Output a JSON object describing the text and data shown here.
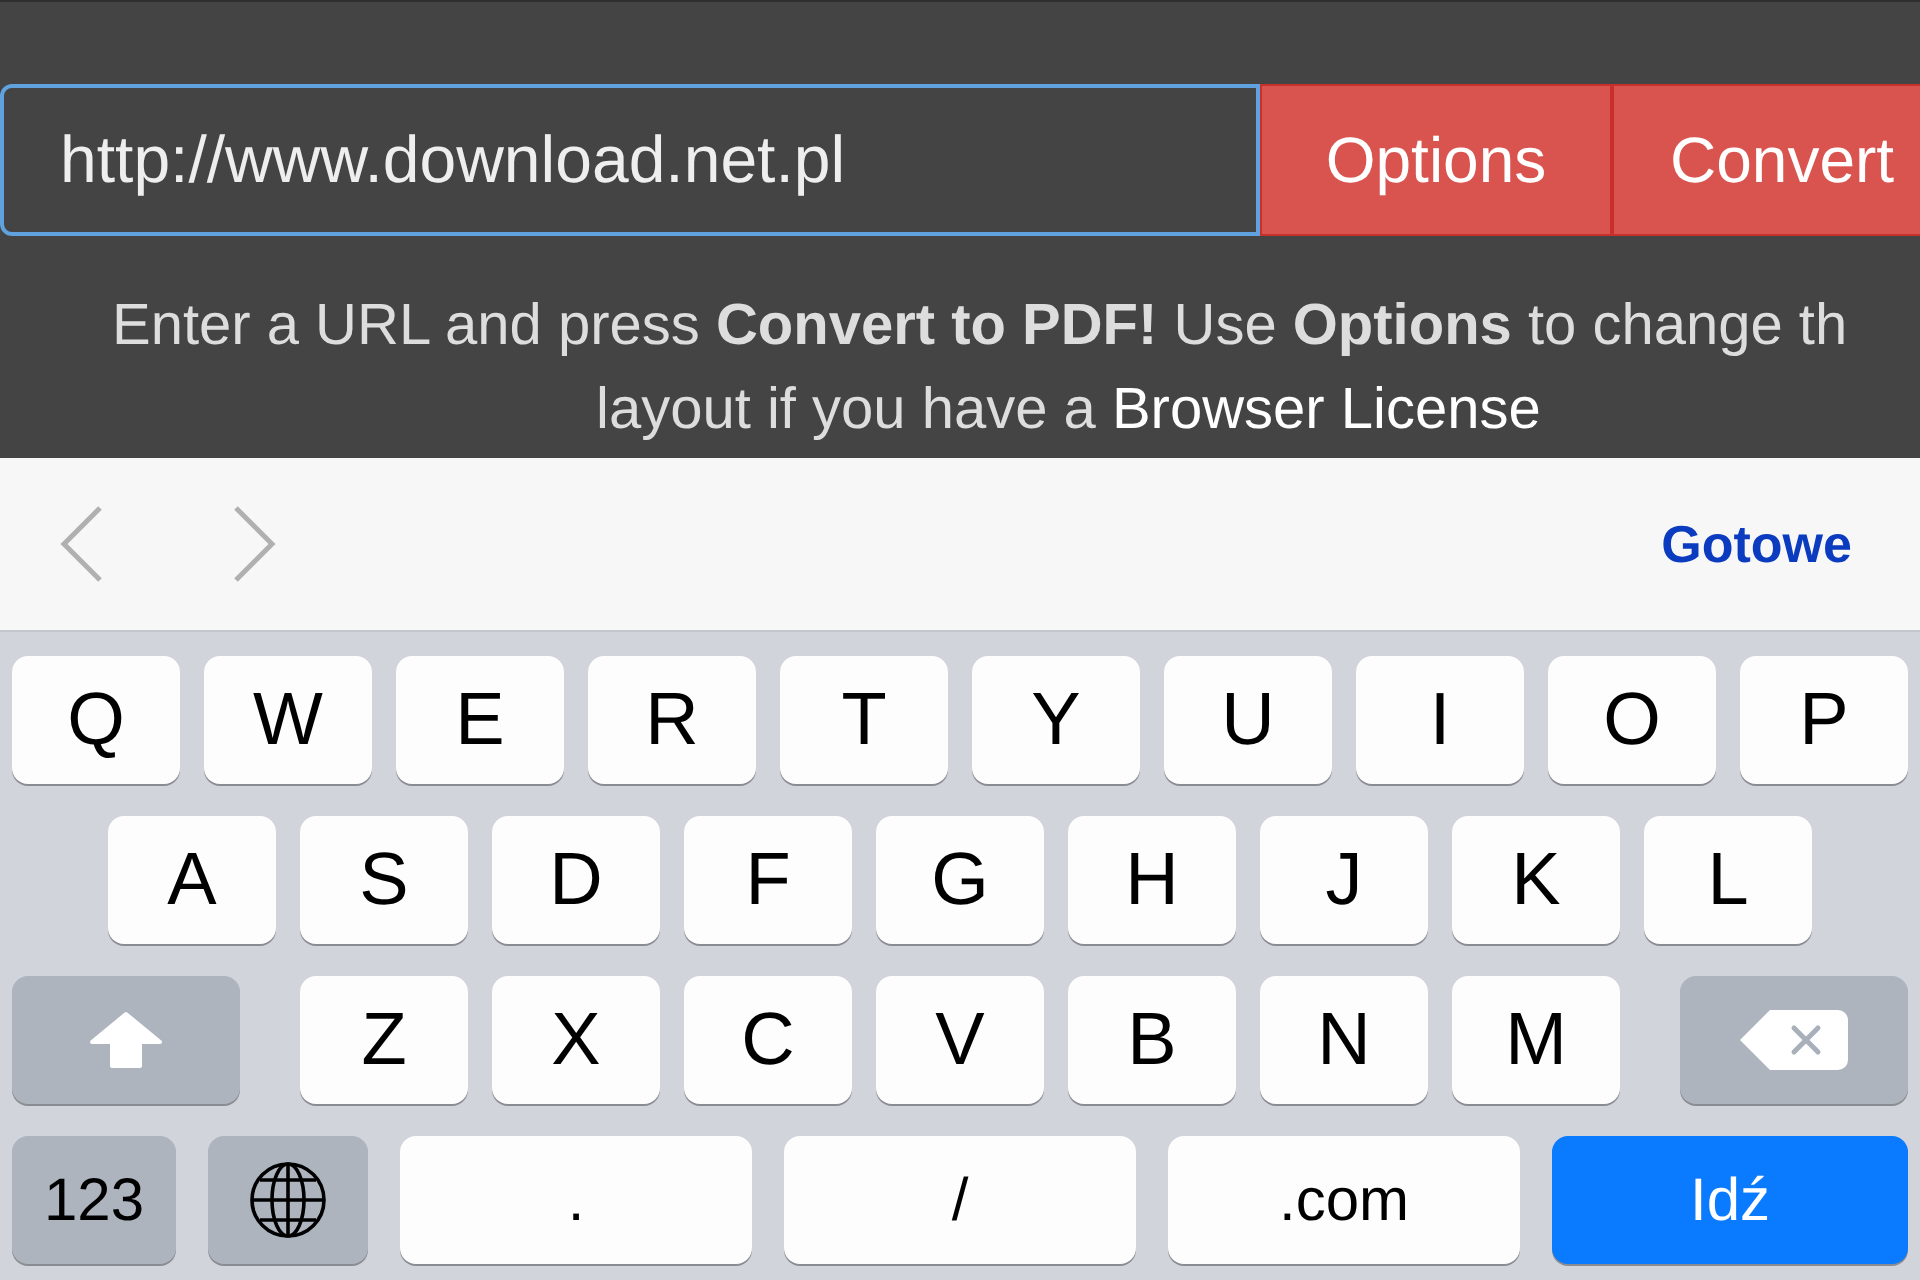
{
  "page": {
    "url_field": {
      "value": "http://www.download.net.pl",
      "focused": true
    },
    "buttons": [
      {
        "kind": "options",
        "label": "Options"
      },
      {
        "kind": "convert",
        "label": "Convert"
      }
    ],
    "instructions": {
      "text": "Enter a URL and press **Convert to PDF!** Use **Options** to change th",
      "continuation": "layout if you have a",
      "link": "Browser License"
    }
  },
  "keyboard_toolbar": {
    "nav": [
      {
        "kind": "previous",
        "disabled": true
      },
      {
        "kind": "next",
        "disabled": true
      }
    ],
    "done": "Gotowe"
  },
  "keyboard": {
    "rows": [
      {
        "keys": [
          {
            "kind": "char",
            "label": "Q"
          },
          {
            "kind": "char",
            "label": "W"
          },
          {
            "kind": "char",
            "label": "E"
          },
          {
            "kind": "char",
            "label": "R"
          },
          {
            "kind": "char",
            "label": "T"
          },
          {
            "kind": "char",
            "label": "Y"
          },
          {
            "kind": "char",
            "label": "U"
          },
          {
            "kind": "char",
            "label": "I"
          },
          {
            "kind": "char",
            "label": "O"
          },
          {
            "kind": "char",
            "label": "P"
          }
        ]
      },
      {
        "keys": [
          {
            "kind": "char",
            "label": "A"
          },
          {
            "kind": "char",
            "label": "S"
          },
          {
            "kind": "char",
            "label": "D"
          },
          {
            "kind": "char",
            "label": "F"
          },
          {
            "kind": "char",
            "label": "G"
          },
          {
            "kind": "char",
            "label": "H"
          },
          {
            "kind": "char",
            "label": "J"
          },
          {
            "kind": "char",
            "label": "K"
          },
          {
            "kind": "char",
            "label": "L"
          }
        ]
      },
      {
        "keys": [
          {
            "kind": "shift"
          },
          {
            "kind": "char",
            "label": "Z"
          },
          {
            "kind": "char",
            "label": "X"
          },
          {
            "kind": "char",
            "label": "C"
          },
          {
            "kind": "char",
            "label": "V"
          },
          {
            "kind": "char",
            "label": "B"
          },
          {
            "kind": "char",
            "label": "N"
          },
          {
            "kind": "char",
            "label": "M"
          },
          {
            "kind": "delete"
          }
        ]
      },
      {
        "keys": [
          {
            "kind": "mode",
            "label": "123"
          },
          {
            "kind": "globe"
          },
          {
            "kind": "char",
            "label": "."
          },
          {
            "kind": "char",
            "label": "/"
          },
          {
            "kind": "char",
            "label": ".com"
          },
          {
            "kind": "go",
            "label": "Idź"
          }
        ]
      }
    ]
  }
}
